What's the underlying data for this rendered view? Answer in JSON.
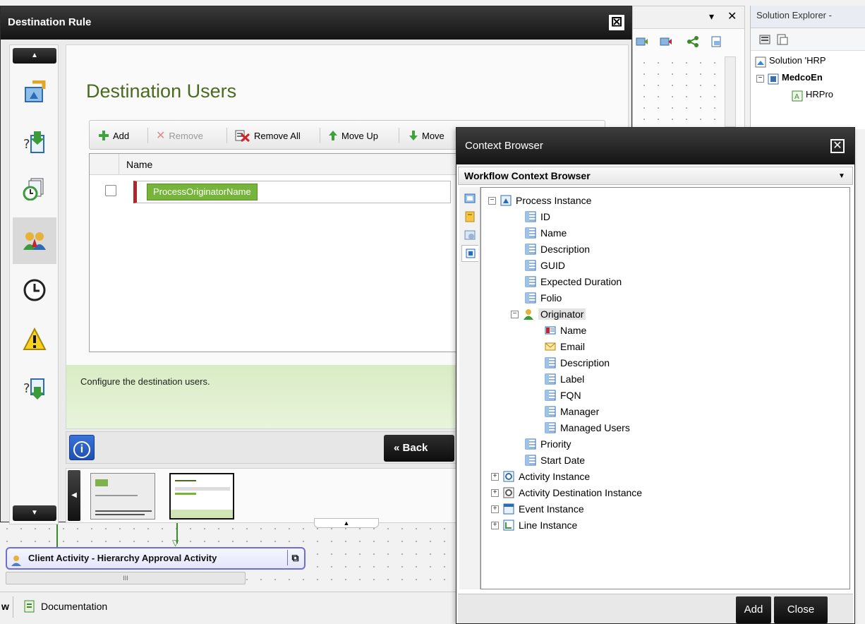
{
  "destination_rule": {
    "title": "Destination Rule",
    "heading": "Destination Users",
    "toolbar": {
      "add": "Add",
      "remove": "Remove",
      "remove_all": "Remove All",
      "move_up": "Move Up",
      "move_down": "Move"
    },
    "grid": {
      "column_name": "Name",
      "rows": [
        {
          "value": "ProcessOriginatorName"
        }
      ]
    },
    "description": "Configure the destination users.",
    "back_label": "Back",
    "info_symbol": "i"
  },
  "background": {
    "solution_explorer": {
      "title": "Solution Explorer -",
      "rows": [
        "Solution 'HRP",
        "MedcoEn",
        "HRPro"
      ]
    },
    "activity_title": "Client Activity - Hierarchy Approval Activity",
    "scroll_grip": "III",
    "bottom_tab": "Documentation",
    "bottom_tab_prefix": "w"
  },
  "context_browser": {
    "title": "Context Browser",
    "dropdown": "Workflow Context Browser",
    "tree": {
      "process_instance": "Process Instance",
      "pi_children": [
        "ID",
        "Name",
        "Description",
        "GUID",
        "Expected Duration",
        "Folio"
      ],
      "originator": "Originator",
      "originator_children": [
        "Name",
        "Email",
        "Description",
        "Label",
        "FQN",
        "Manager",
        "Managed Users"
      ],
      "pi_children_after": [
        "Priority",
        "Start Date"
      ],
      "roots": [
        "Activity Instance",
        "Activity Destination Instance",
        "Event Instance",
        "Line Instance"
      ]
    },
    "add_label": "Add",
    "close_label": "Close"
  },
  "colors": {
    "heading_green": "#4a6b1f",
    "token_green": "#77b43a",
    "row_marker_red": "#b2262b",
    "activity_border": "#6d6ddb"
  }
}
